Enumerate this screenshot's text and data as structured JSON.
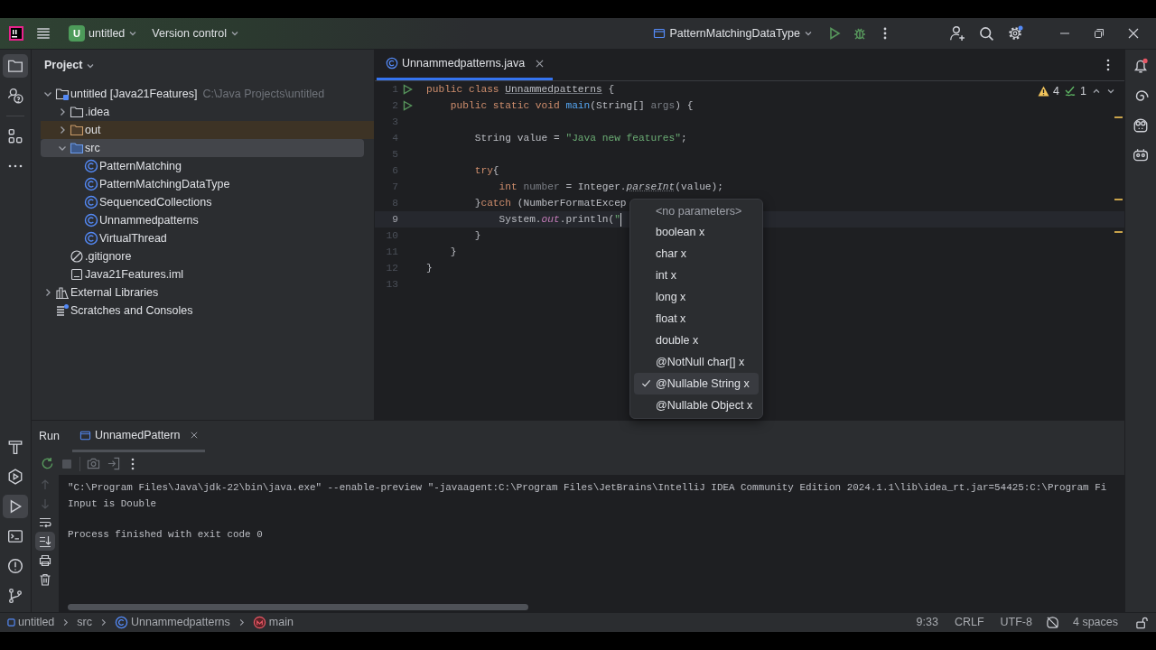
{
  "title_bar": {
    "project_badge": "U",
    "project": "untitled",
    "vcs": "Version control",
    "run_config": "PatternMatchingDataType"
  },
  "project_panel": {
    "title": "Project",
    "tree": [
      {
        "label": "untitled [Java21Features]",
        "path": "C:\\Java Projects\\untitled",
        "kind": "module",
        "expanded": true,
        "selected": false,
        "children": [
          {
            "label": ".idea",
            "kind": "folder",
            "expanded": false,
            "selected": false
          },
          {
            "label": "out",
            "kind": "excluded-folder",
            "expanded": false,
            "selected": false
          },
          {
            "label": "src",
            "kind": "source-folder",
            "expanded": true,
            "selected": true,
            "children": [
              {
                "label": "PatternMatching",
                "kind": "class",
                "selected": false
              },
              {
                "label": "PatternMatchingDataType",
                "kind": "class",
                "selected": false
              },
              {
                "label": "SequencedCollections",
                "kind": "class",
                "selected": false
              },
              {
                "label": "Unnammedpatterns",
                "kind": "class",
                "selected": false
              },
              {
                "label": "VirtualThread",
                "kind": "class",
                "selected": false
              }
            ]
          },
          {
            "label": ".gitignore",
            "kind": "ignore",
            "selected": false
          },
          {
            "label": "Java21Features.iml",
            "kind": "iml",
            "selected": false
          }
        ]
      },
      {
        "label": "External Libraries",
        "kind": "libraries",
        "expanded": false,
        "selected": false
      },
      {
        "label": "Scratches and Consoles",
        "kind": "scratches",
        "selected": false
      }
    ]
  },
  "editor": {
    "tabs": [
      {
        "label": "Unnammedpatterns.java",
        "selected": true
      }
    ],
    "warnings": "4",
    "weak_warnings": "1",
    "lines": [
      {
        "number": "1",
        "kind": "runnable",
        "current": false,
        "tokens": [
          {
            "text": "public class ",
            "kind": "kw"
          },
          {
            "text": "Unnammedpatterns",
            "kind": "cls"
          },
          {
            "text": " {",
            "kind": "plain"
          }
        ]
      },
      {
        "number": "2",
        "kind": "runnable",
        "current": false,
        "tokens": [
          {
            "text": "    public static void ",
            "kind": "kw"
          },
          {
            "text": "main",
            "kind": "method"
          },
          {
            "text": "(String[] ",
            "kind": "plain"
          },
          {
            "text": "args",
            "kind": "unused"
          },
          {
            "text": ") {",
            "kind": "plain"
          }
        ]
      },
      {
        "number": "3",
        "kind": "plain",
        "current": false
      },
      {
        "number": "4",
        "kind": "plain",
        "current": false,
        "tokens": [
          {
            "text": "        String value = ",
            "kind": "plain"
          },
          {
            "text": "\"Java new features\"",
            "kind": "str"
          },
          {
            "text": ";",
            "kind": "plain"
          }
        ]
      },
      {
        "number": "5",
        "kind": "plain",
        "current": false
      },
      {
        "number": "6",
        "kind": "plain",
        "current": false,
        "tokens": [
          {
            "text": "        try",
            "kind": "kw"
          },
          {
            "text": "{",
            "kind": "plain"
          }
        ]
      },
      {
        "number": "7",
        "kind": "plain",
        "current": false,
        "tokens": [
          {
            "text": "            int ",
            "kind": "kw"
          },
          {
            "text": "number",
            "kind": "unused"
          },
          {
            "text": " = Integer.",
            "kind": "plain"
          },
          {
            "text": "parseInt",
            "kind": "static"
          },
          {
            "text": "(value);",
            "kind": "plain"
          }
        ]
      },
      {
        "number": "8",
        "kind": "plain",
        "current": false,
        "tokens": [
          {
            "text": "        }",
            "kind": "plain"
          },
          {
            "text": "catch ",
            "kind": "kw"
          },
          {
            "text": "(NumberFormatExcep",
            "kind": "plain"
          }
        ]
      },
      {
        "number": "9",
        "kind": "plain",
        "current": true,
        "tokens": [
          {
            "text": "            System.",
            "kind": "plain"
          },
          {
            "text": "out",
            "kind": "field"
          },
          {
            "text": ".println(",
            "kind": "plain"
          },
          {
            "text": "\"",
            "kind": "str"
          }
        ]
      },
      {
        "number": "10",
        "kind": "plain",
        "current": false,
        "tokens": [
          {
            "text": "        }",
            "kind": "plain"
          }
        ]
      },
      {
        "number": "11",
        "kind": "plain",
        "current": false,
        "tokens": [
          {
            "text": "    }",
            "kind": "plain"
          }
        ]
      },
      {
        "number": "12",
        "kind": "plain",
        "current": false,
        "tokens": [
          {
            "text": "}",
            "kind": "plain"
          }
        ]
      },
      {
        "number": "13",
        "kind": "plain",
        "current": false
      }
    ]
  },
  "parameter_popup": {
    "items": [
      {
        "label": "<no parameters>",
        "kind": "hint",
        "selected": false
      },
      {
        "label": "boolean x",
        "kind": "signature",
        "selected": false
      },
      {
        "label": "char x",
        "kind": "signature",
        "selected": false
      },
      {
        "label": "int x",
        "kind": "signature",
        "selected": false
      },
      {
        "label": "long x",
        "kind": "signature",
        "selected": false
      },
      {
        "label": "float x",
        "kind": "signature",
        "selected": false
      },
      {
        "label": "double x",
        "kind": "signature",
        "selected": false
      },
      {
        "label": "@NotNull char[] x",
        "kind": "signature",
        "selected": false
      },
      {
        "label": "@Nullable String x",
        "kind": "signature",
        "selected": true
      },
      {
        "label": "@Nullable Object x",
        "kind": "signature",
        "selected": false
      }
    ]
  },
  "run_panel": {
    "title": "Run",
    "tabs": [
      {
        "label": "UnnamedPattern",
        "selected": true
      }
    ],
    "command": "\"C:\\Program Files\\Java\\jdk-22\\bin\\java.exe\" --enable-preview \"-javaagent:C:\\Program Files\\JetBrains\\IntelliJ IDEA Community Edition 2024.1.1\\lib\\idea_rt.jar=54425:C:\\Program Fi",
    "output": [
      "Input is Double"
    ],
    "exit_message": "Process finished with exit code 0"
  },
  "status_bar": {
    "breadcrumbs": [
      {
        "label": "untitled",
        "kind": "module"
      },
      {
        "label": "src",
        "kind": "folder"
      },
      {
        "label": "Unnammedpatterns",
        "kind": "class"
      },
      {
        "label": "main",
        "kind": "method"
      }
    ],
    "position": "9:33",
    "line_ending": "CRLF",
    "encoding": "UTF-8",
    "indent": "4 spaces"
  }
}
